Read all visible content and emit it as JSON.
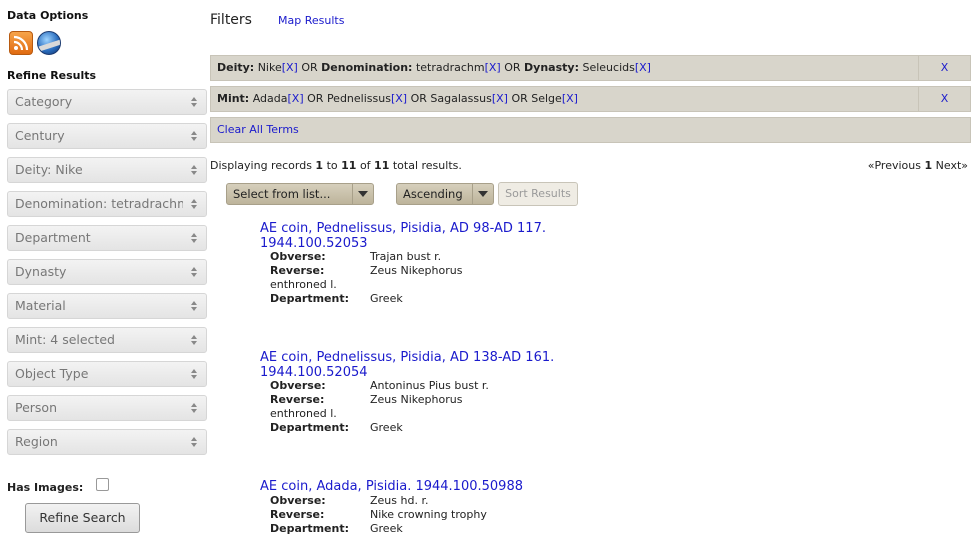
{
  "sidebar": {
    "data_options_title": "Data Options",
    "feed_icon": "rss-feed-icon",
    "earth_icon": "google-earth-icon",
    "refine_title": "Refine Results",
    "facets": [
      "Category",
      "Century",
      "Deity: Nike",
      "Denomination: tetradrachm",
      "Department",
      "Dynasty",
      "Material",
      "Mint: 4 selected",
      "Object Type",
      "Person",
      "Region"
    ],
    "has_images_label": "Has Images:",
    "has_images_checked": false,
    "refine_button": "Refine Search"
  },
  "filters": {
    "heading": "Filters",
    "map_link": "Map Results",
    "row1": {
      "deity_label": "Deity:",
      "deity_value": "Nike",
      "or1": "OR",
      "denom_label": "Denomination:",
      "denom_value": "tetradrachm",
      "or2": "OR",
      "dynasty_label": "Dynasty:",
      "dynasty_value": "Seleucids",
      "remove": "X"
    },
    "row2": {
      "mint_label": "Mint:",
      "mints": [
        "Adada",
        "Pednelissus",
        "Sagalassus",
        "Selge"
      ],
      "or": "OR",
      "remove": "X"
    },
    "term_x": "[X]",
    "clear_all": "Clear All Terms"
  },
  "results": {
    "displaying": "Displaying records",
    "from": "1",
    "to_word": "to",
    "to": "11",
    "of_word": "of",
    "total": "11",
    "total_suffix": "total results.",
    "prev": "«Previous",
    "current_page": "1",
    "next": "Next»",
    "sort_field_value": "Select from list...",
    "sort_order_value": "Ascending",
    "sort_button": "Sort Results",
    "labels": {
      "obverse": "Obverse:",
      "reverse": "Reverse:",
      "department": "Department:"
    },
    "records": [
      {
        "title": "AE coin, Pednelissus, Pisidia, AD 98-AD 117. 1944.100.52053",
        "obverse": "Trajan bust r.",
        "reverse": "Zeus Nikephorus",
        "reverse_wrap": "enthroned l.",
        "department": "Greek"
      },
      {
        "title": "AE coin, Pednelissus, Pisidia, AD 138-AD 161. 1944.100.52054",
        "obverse": "Antoninus Pius bust r.",
        "reverse": "Zeus Nikephorus",
        "reverse_wrap": "enthroned l.",
        "department": "Greek"
      },
      {
        "title": "AE coin, Adada, Pisidia. 1944.100.50988",
        "obverse": "Zeus hd. r.",
        "reverse": "Nike crowning trophy",
        "department": "Greek"
      }
    ]
  }
}
